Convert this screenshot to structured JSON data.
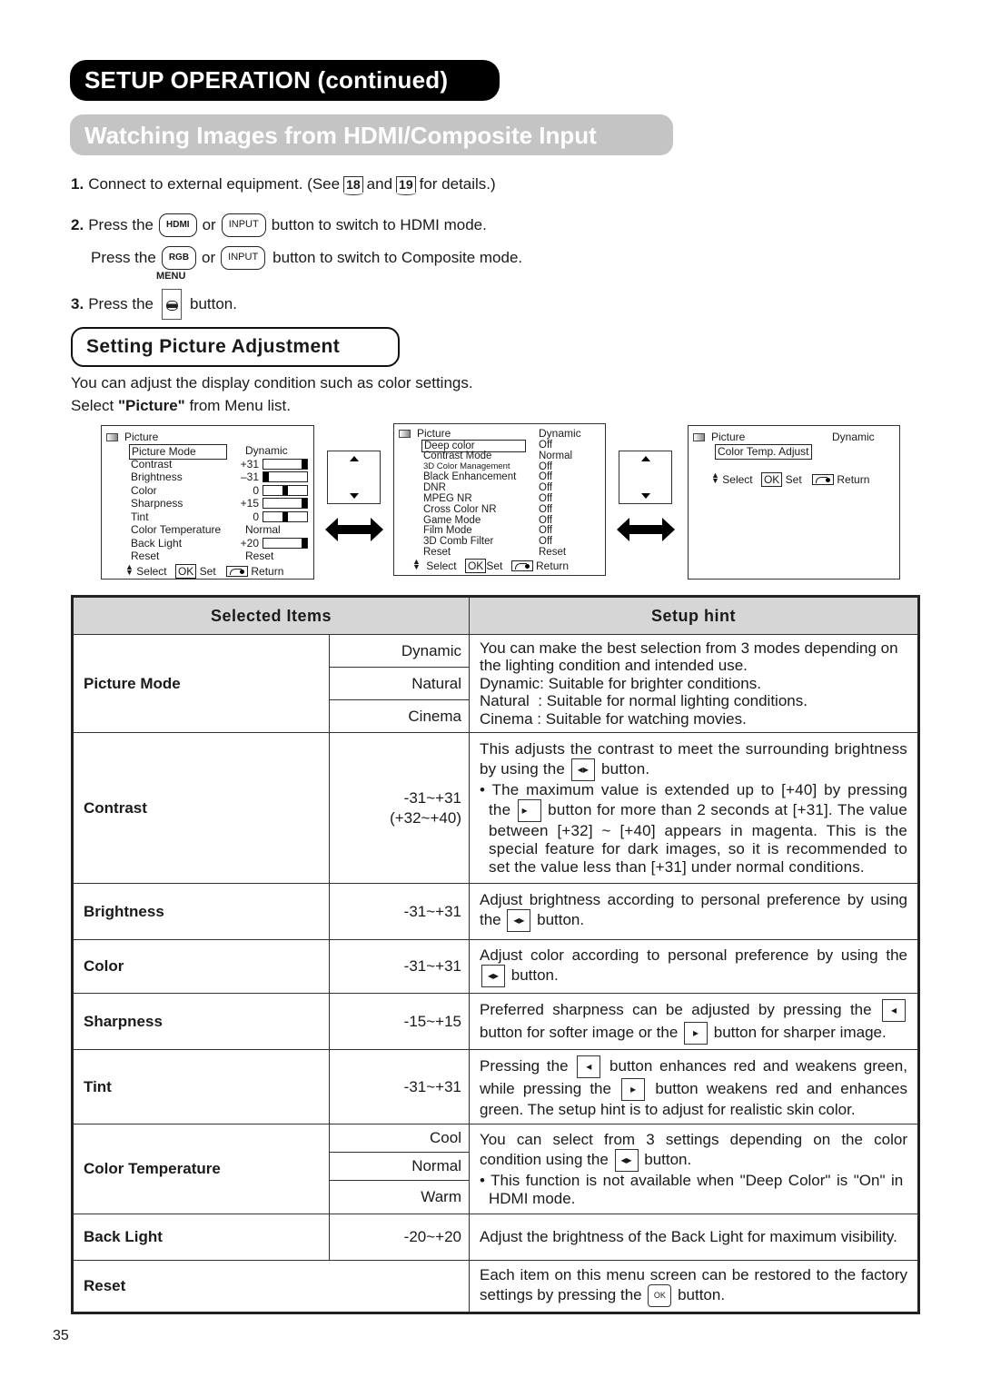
{
  "header": {
    "title": "SETUP OPERATION (continued)",
    "subtitle": "Watching Images from HDMI/Composite Input"
  },
  "steps": {
    "step1": {
      "num": "1.",
      "text_a": "Connect to external equipment. (See",
      "ref1": "18",
      "and": "and",
      "ref2": "19",
      "text_b": "for details.)"
    },
    "step2": {
      "num": "2.",
      "press": "Press the",
      "btn1": "HDMI",
      "or": "or",
      "btn2": "INPUT",
      "text": "button to switch to HDMI mode."
    },
    "step2b": {
      "press": "Press the",
      "btn1": "RGB",
      "or": "or",
      "btn2": "INPUT",
      "text": "button to switch to Composite mode."
    },
    "step3": {
      "num": "3.",
      "press": "Press the",
      "btn_label": "MENU",
      "text": "button."
    }
  },
  "section": {
    "title": "Setting Picture Adjustment",
    "intro1": "You can adjust the display condition such as color settings.",
    "intro2_a": "Select ",
    "intro2_b": "\"Picture\"",
    "intro2_c": " from Menu list."
  },
  "osd1": {
    "title": "Picture",
    "items": [
      {
        "label": "Picture Mode",
        "value": "Dynamic",
        "selected": true
      },
      {
        "label": "Contrast",
        "value": "+31",
        "bar": 1.0
      },
      {
        "label": "Brightness",
        "value": "–31",
        "bar": 0.0
      },
      {
        "label": "Color",
        "value": "0",
        "bar": 0.5
      },
      {
        "label": "Sharpness",
        "value": "+15",
        "bar": 1.0
      },
      {
        "label": "Tint",
        "value": "0",
        "bar": 0.5
      },
      {
        "label": "Color Temperature",
        "value": "Normal"
      },
      {
        "label": "Back Light",
        "value": "+20",
        "bar": 1.0
      },
      {
        "label": "Reset",
        "value": "Reset"
      }
    ],
    "footer": {
      "select": "Select",
      "ok": "OK",
      "set": "Set",
      "ret": "Return"
    }
  },
  "osd2": {
    "title": "Picture",
    "mode": "Dynamic",
    "items": [
      {
        "label": "Deep color",
        "value": "Off",
        "selected": true
      },
      {
        "label": "Contrast Mode",
        "value": "Normal"
      },
      {
        "label": "3D Color Management",
        "value": "Off",
        "small": true
      },
      {
        "label": "Black Enhancement",
        "value": "Off"
      },
      {
        "label": "DNR",
        "value": "Off"
      },
      {
        "label": "MPEG NR",
        "value": "Off"
      },
      {
        "label": "Cross Color NR",
        "value": "Off"
      },
      {
        "label": "Game Mode",
        "value": "Off"
      },
      {
        "label": "Film Mode",
        "value": "Off"
      },
      {
        "label": "3D Comb Filter",
        "value": "Off"
      },
      {
        "label": "Reset",
        "value": "Reset"
      }
    ],
    "footer": {
      "select": "Select",
      "ok": "OK",
      "set": "Set",
      "ret": "Return"
    }
  },
  "osd3": {
    "title": "Picture",
    "mode": "Dynamic",
    "items": [
      {
        "label": "Color Temp. Adjust",
        "selected": true
      }
    ],
    "footer": {
      "select": "Select",
      "ok": "OK",
      "set": "Set",
      "ret": "Return"
    }
  },
  "table": {
    "headers": [
      "Selected Items",
      "Setup hint"
    ],
    "rows": {
      "picture_mode": {
        "item": "Picture Mode",
        "options": [
          "Dynamic",
          "Natural",
          "Cinema"
        ],
        "hint": [
          "You can make the best selection from 3 modes depending on the lighting condition and intended use.",
          "Dynamic: Suitable for brighter conditions.",
          "Natural  : Suitable for normal lighting conditions.",
          "Cinema : Suitable for watching movies."
        ]
      },
      "contrast": {
        "item": "Contrast",
        "range": "-31~+31",
        "range2": "(+32~+40)",
        "hint_a": "This adjusts the contrast to meet the surrounding brightness by using the",
        "hint_b": "button.",
        "bullet_a": "• The maximum value is extended up to [+40] by pressing the",
        "bullet_b": "button for more than 2 seconds at [+31]. The value between [+32] ~ [+40] appears in magenta. This is the special feature for dark images, so it is recommended to set the value less than [+31] under normal conditions."
      },
      "brightness": {
        "item": "Brightness",
        "range": "-31~+31",
        "hint_a": "Adjust brightness according to personal preference by using the",
        "hint_b": "button."
      },
      "color": {
        "item": "Color",
        "range": "-31~+31",
        "hint_a": "Adjust color according to personal preference by using the",
        "hint_b": "button."
      },
      "sharpness": {
        "item": "Sharpness",
        "range": "-15~+15",
        "hint_a": "Preferred sharpness can be adjusted by pressing the",
        "hint_b": "button for softer image or the",
        "hint_c": "button for sharper image."
      },
      "tint": {
        "item": "Tint",
        "range": "-31~+31",
        "hint_a": "Pressing the",
        "hint_b": "button enhances red and weakens green, while pressing the",
        "hint_c": "button weakens red and enhances green. The setup hint is to adjust for realistic skin color."
      },
      "color_temp": {
        "item": "Color Temperature",
        "options": [
          "Cool",
          "Normal",
          "Warm"
        ],
        "hint_a": "You can select from 3 settings depending on the color condition using the",
        "hint_b": "button.",
        "bullet": "• This function is not available when \"Deep Color\" is \"On\" in  HDMI mode."
      },
      "back_light": {
        "item": "Back Light",
        "range": "-20~+20",
        "hint": "Adjust the brightness of the Back Light for maximum visibility."
      },
      "reset": {
        "item": "Reset",
        "hint_a": "Each item on this menu screen can be restored to the factory settings by pressing the",
        "ok": "OK",
        "hint_b": "button."
      }
    }
  },
  "page_number": "35"
}
